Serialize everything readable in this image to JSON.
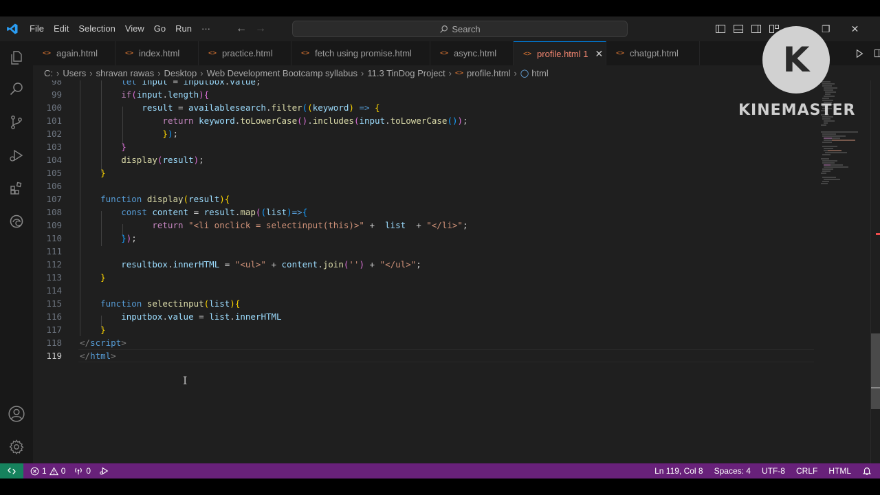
{
  "menu": [
    "File",
    "Edit",
    "Selection",
    "View",
    "Go",
    "Run",
    "···"
  ],
  "search": {
    "label": "Search"
  },
  "tabs": [
    {
      "label": "again.html",
      "active": false
    },
    {
      "label": "index.html",
      "active": false
    },
    {
      "label": "practice.html",
      "active": false
    },
    {
      "label": "fetch using promise.html",
      "active": false
    },
    {
      "label": "async.html",
      "active": false
    },
    {
      "label": "profile.html 1",
      "active": true
    },
    {
      "label": "chatgpt.html",
      "active": false
    }
  ],
  "tab_icon": "<>",
  "breadcrumb": [
    "C:",
    "Users",
    "shravan rawas",
    "Desktop",
    "Web Development Bootcamp syllabus",
    "11.3 TinDog Project",
    "profile.html",
    "html"
  ],
  "editor": {
    "line_numbers": [
      "98",
      "99",
      "100",
      "101",
      "102",
      "103",
      "104",
      "105",
      "106",
      "107",
      "108",
      "109",
      "110",
      "111",
      "112",
      "113",
      "114",
      "115",
      "116",
      "117",
      "118",
      "119"
    ],
    "current_line": "119"
  },
  "statusbar": {
    "errors": "1",
    "warnings": "0",
    "ports": "0",
    "position": "Ln 119, Col 8",
    "spaces": "Spaces: 4",
    "encoding": "UTF-8",
    "eol": "CRLF",
    "language": "HTML"
  },
  "watermark": {
    "letter": "K",
    "text": "KINEMASTER"
  },
  "colors": {
    "accent": "#0078d4",
    "statusbar": "#68217a",
    "remote": "#16825d",
    "modified_tab": "#f48771"
  }
}
